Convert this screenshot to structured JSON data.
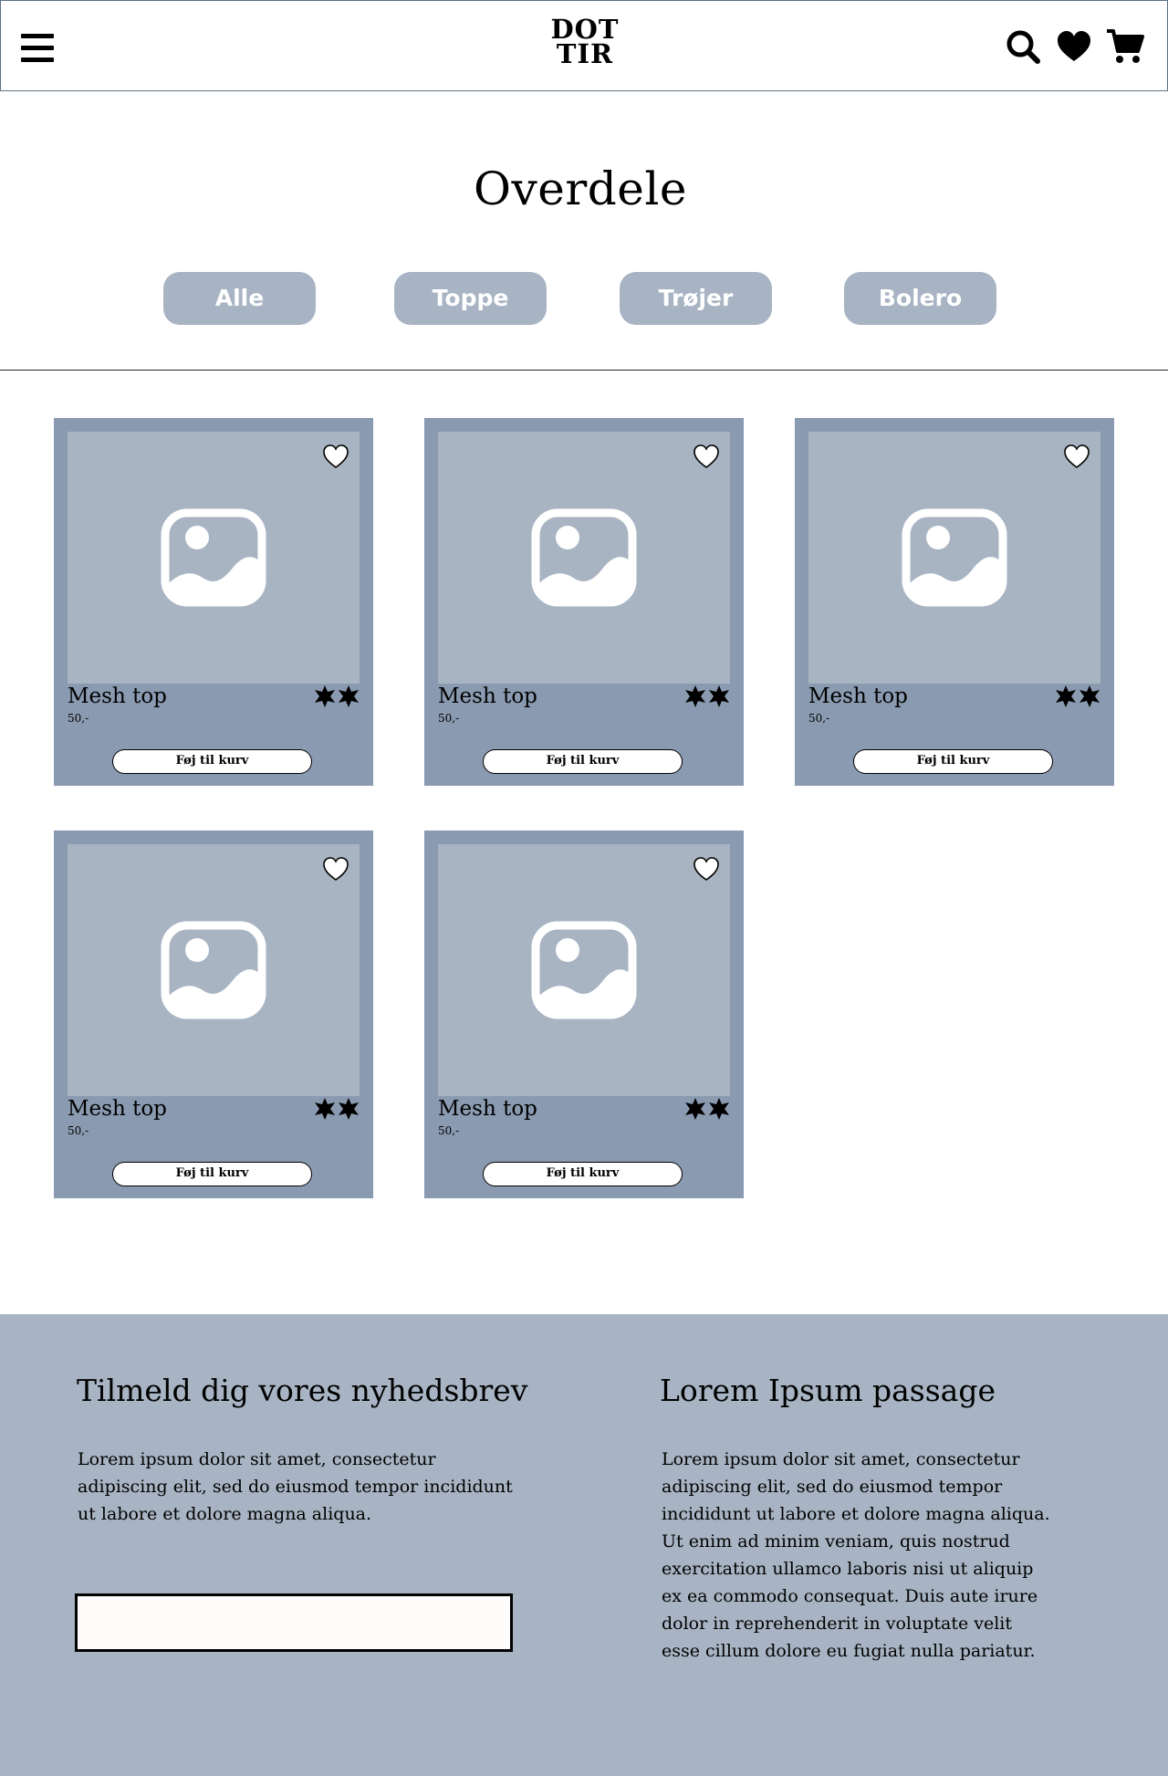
{
  "header": {
    "logo": {
      "line1": "DOT",
      "line2": "TIR"
    },
    "icons": [
      "menu-icon",
      "search-icon",
      "heart-icon",
      "cart-icon"
    ]
  },
  "page": {
    "title": "Overdele"
  },
  "filters": [
    {
      "label": "Alle"
    },
    {
      "label": "Toppe"
    },
    {
      "label": "Trøjer"
    },
    {
      "label": "Bolero"
    }
  ],
  "products": [
    {
      "name": "Mesh top",
      "price": "50,-",
      "button": "Føj til kurv"
    },
    {
      "name": "Mesh top",
      "price": "50,-",
      "button": "Føj til kurv"
    },
    {
      "name": "Mesh top",
      "price": "50,-",
      "button": "Føj til kurv"
    },
    {
      "name": "Mesh top",
      "price": "50,-",
      "button": "Føj til kurv"
    },
    {
      "name": "Mesh top",
      "price": "50,-",
      "button": "Føj til kurv"
    }
  ],
  "footer": {
    "newsletter": {
      "title": "Tilmeld dig vores nyhedsbrev",
      "text": "Lorem ipsum dolor sit amet, consectetur adipiscing elit, sed do eiusmod tempor incididunt ut labore et dolore magna aliqua.",
      "input_value": ""
    },
    "passage": {
      "title": "Lorem Ipsum passage",
      "text": "Lorem ipsum dolor sit amet, consectetur adipiscing elit, sed do eiusmod tempor incididunt ut labore et dolore magna aliqua. Ut enim ad minim veniam, quis nostrud exercitation ullamco laboris nisi ut aliquip ex ea commodo consequat. Duis aute irure dolor in reprehenderit in voluptate velit esse cillum dolore eu fugiat nulla pariatur."
    }
  },
  "colors": {
    "card": "#8a9ab0",
    "image_placeholder": "#a8b4c2",
    "pill": "#a8b4c3",
    "footer": "#a8b4c3",
    "header_border": "#5f7185"
  }
}
